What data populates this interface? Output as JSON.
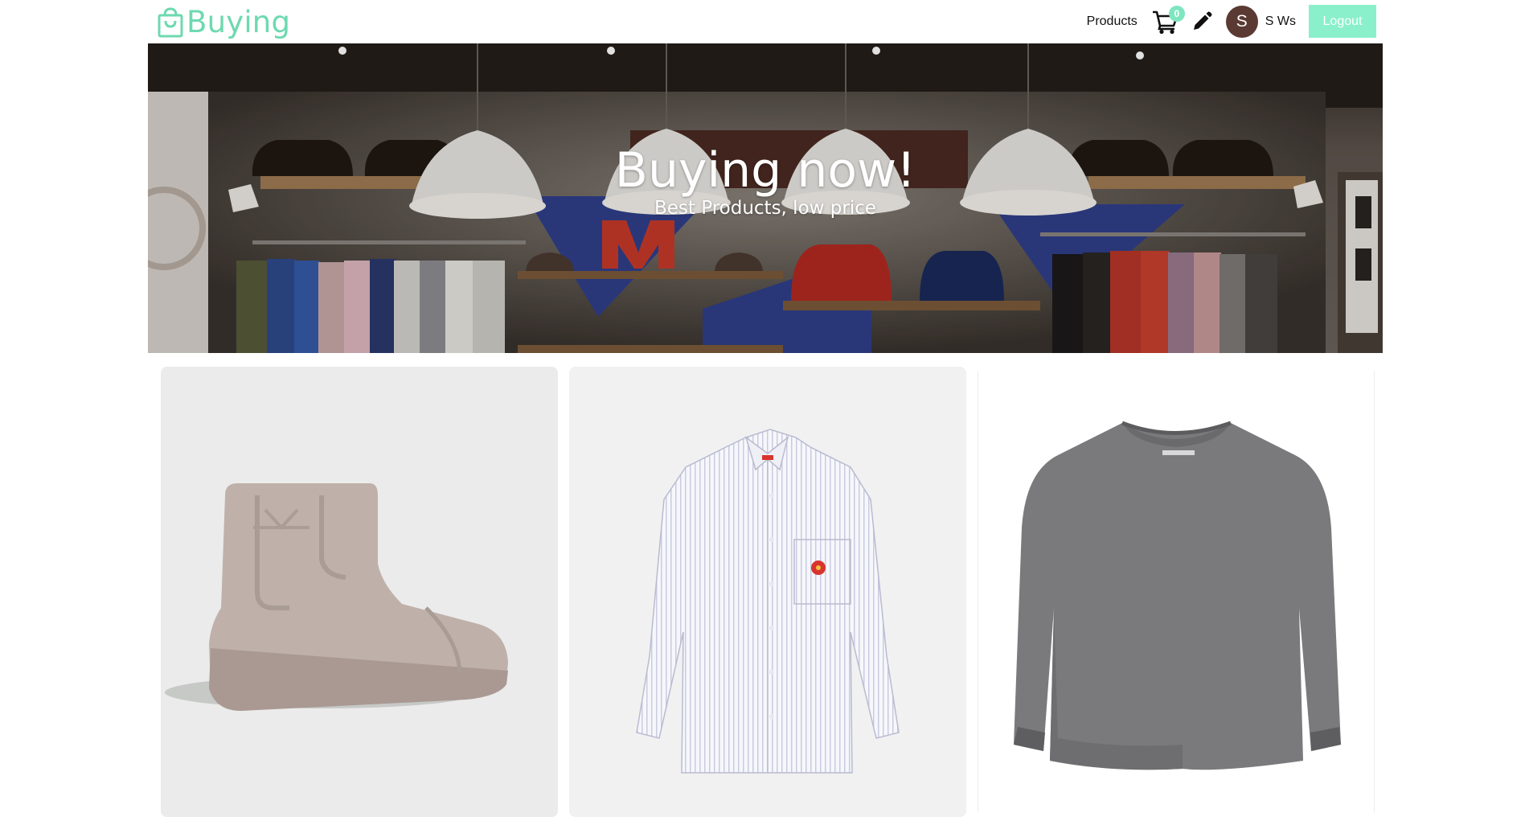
{
  "brand": {
    "name": "Buying",
    "color": "#6ed9b0"
  },
  "nav": {
    "products_label": "Products",
    "cart_count": "0",
    "avatar_initial": "S",
    "username": "S Ws",
    "logout_label": "Logout",
    "accent_color": "#8af0cc"
  },
  "hero": {
    "title": "Buying now!",
    "subtitle": "Best Products, low price"
  },
  "products": [
    {
      "image": "beige-rubber-boot",
      "background": "#ebebeb"
    },
    {
      "image": "striped-white-shirt",
      "background": "#f1f1f1"
    },
    {
      "image": "grey-knit-sweater",
      "background": "#ffffff"
    }
  ]
}
